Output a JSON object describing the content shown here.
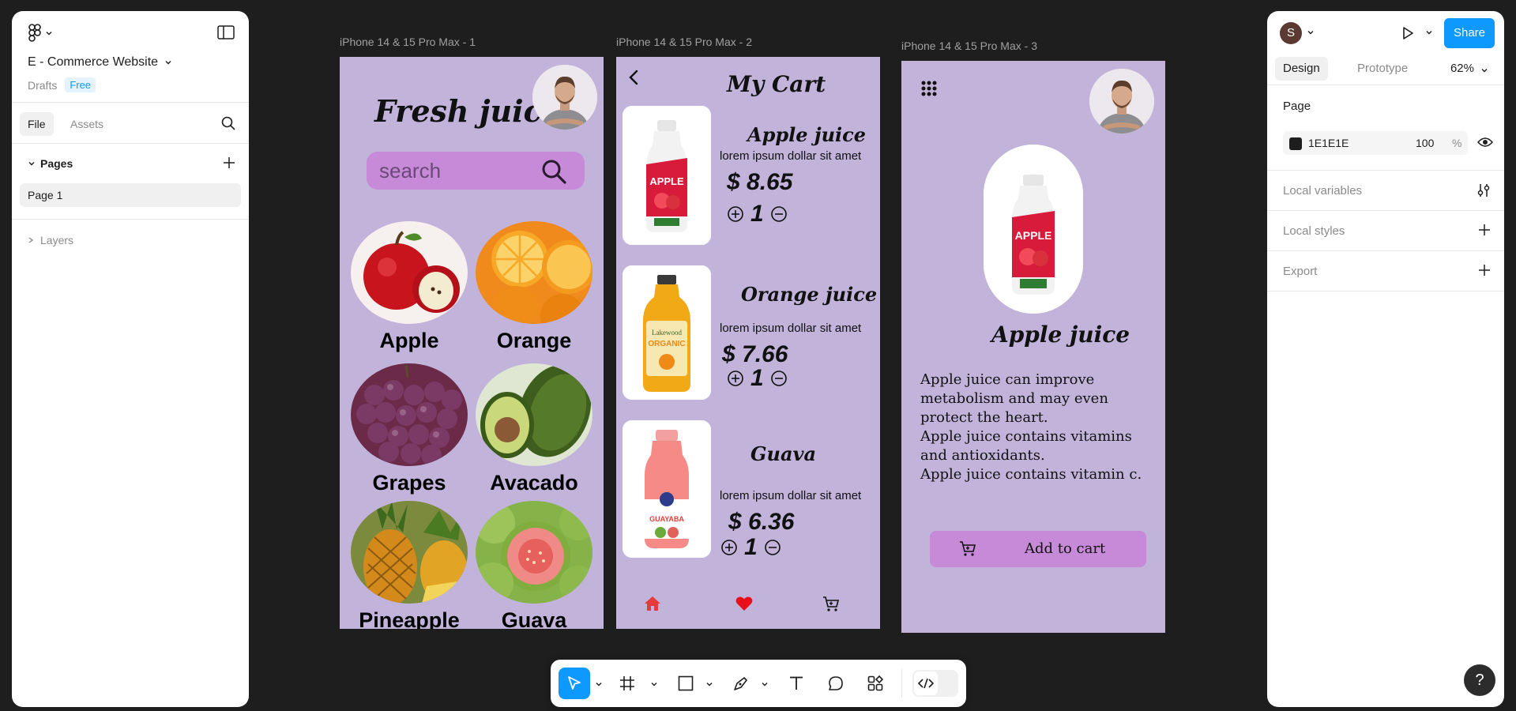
{
  "left_panel": {
    "file_name": "E - Commerce Website",
    "drafts": "Drafts",
    "plan_badge": "Free",
    "tabs": [
      "File",
      "Assets"
    ],
    "pages_label": "Pages",
    "pages": [
      "Page 1"
    ],
    "layers_label": "Layers"
  },
  "right_panel": {
    "avatar_initial": "S",
    "share_label": "Share",
    "tabs": [
      "Design",
      "Prototype"
    ],
    "zoom": "62%",
    "page_section": "Page",
    "page_color_hex": "1E1E1E",
    "page_opacity": "100",
    "percent_sign": "%",
    "local_variables": "Local variables",
    "local_styles": "Local styles",
    "export": "Export",
    "help": "?"
  },
  "frames": [
    {
      "label": "iPhone 14 & 15 Pro Max - 1"
    },
    {
      "label": "iPhone 14 & 15 Pro Max - 2"
    },
    {
      "label": "iPhone 14 & 15 Pro Max - 3"
    }
  ],
  "home": {
    "title": "Fresh juice",
    "search_placeholder": "search",
    "fruits": [
      "Apple",
      "Orange",
      "Grapes",
      "Avacado",
      "Pineapple",
      "Guava"
    ]
  },
  "cart": {
    "title": "My Cart",
    "items": [
      {
        "name": "Apple juice",
        "desc": "lorem ipsum dollar sit amet",
        "price": "$ 8.65",
        "qty": "1"
      },
      {
        "name": "Orange juice",
        "desc": "lorem ipsum dollar sit amet",
        "price": "$ 7.66",
        "qty": "1"
      },
      {
        "name": "Guava",
        "desc": "lorem ipsum dollar sit amet",
        "price": "$ 6.36",
        "qty": "1"
      }
    ]
  },
  "detail": {
    "name": "Apple juice",
    "lines": [
      "Apple juice can improve metabolism and may even protect the heart.",
      "Apple juice contains vitamins and antioxidants.",
      "Apple juice contains vitamin c."
    ],
    "add_to_cart": "Add to cart"
  },
  "colors": {
    "canvas": "#1E1E1E",
    "frame_bg": "#C2B3DB",
    "accent_pink": "#C78AD9",
    "figma_blue": "#0d99ff"
  }
}
